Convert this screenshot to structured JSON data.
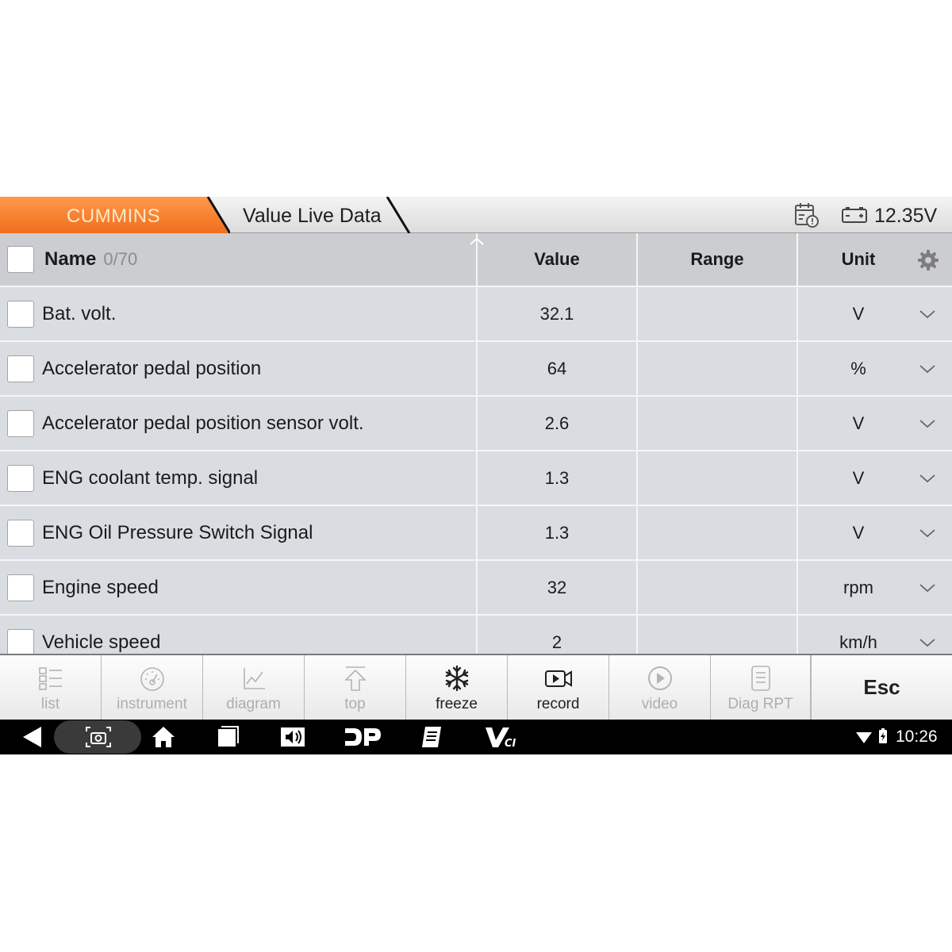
{
  "header": {
    "brand_tab": "CUMMINS",
    "title_tab": "Value Live Data",
    "voltage": "12.35V",
    "brand_color": "#f57c2b"
  },
  "table": {
    "columns": {
      "name": "Name",
      "count": "0/70",
      "value": "Value",
      "range": "Range",
      "unit": "Unit"
    },
    "rows": [
      {
        "name": "Bat. volt.",
        "value": "32.1",
        "range": "",
        "unit": "V"
      },
      {
        "name": "Accelerator pedal position",
        "value": "64",
        "range": "",
        "unit": "%"
      },
      {
        "name": "Accelerator pedal position sensor volt.",
        "value": "2.6",
        "range": "",
        "unit": "V"
      },
      {
        "name": "ENG coolant temp. signal",
        "value": "1.3",
        "range": "",
        "unit": "V"
      },
      {
        "name": "ENG Oil Pressure Switch Signal",
        "value": "1.3",
        "range": "",
        "unit": "V"
      },
      {
        "name": "Engine speed",
        "value": "32",
        "range": "",
        "unit": "rpm"
      },
      {
        "name": "Vehicle speed",
        "value": "2",
        "range": "",
        "unit": "km/h"
      }
    ]
  },
  "toolbar": {
    "buttons": [
      {
        "label": "list",
        "icon": "list-icon",
        "enabled": false
      },
      {
        "label": "instrument",
        "icon": "gauge-icon",
        "enabled": false
      },
      {
        "label": "diagram",
        "icon": "chart-icon",
        "enabled": false
      },
      {
        "label": "top",
        "icon": "arrow-up-icon",
        "enabled": false
      },
      {
        "label": "freeze",
        "icon": "snowflake-icon",
        "enabled": true
      },
      {
        "label": "record",
        "icon": "video-camera-icon",
        "enabled": true
      },
      {
        "label": "video",
        "icon": "play-circle-icon",
        "enabled": false
      },
      {
        "label": "Diag RPT",
        "icon": "report-icon",
        "enabled": false
      }
    ],
    "esc_label": "Esc"
  },
  "system_bar": {
    "time": "10:26",
    "icons": [
      "back-icon",
      "screenshot-icon",
      "home-icon",
      "recents-icon",
      "audio-icon",
      "dp-icon",
      "notes-icon",
      "vci-icon",
      "wifi-icon",
      "battery-icon"
    ]
  }
}
